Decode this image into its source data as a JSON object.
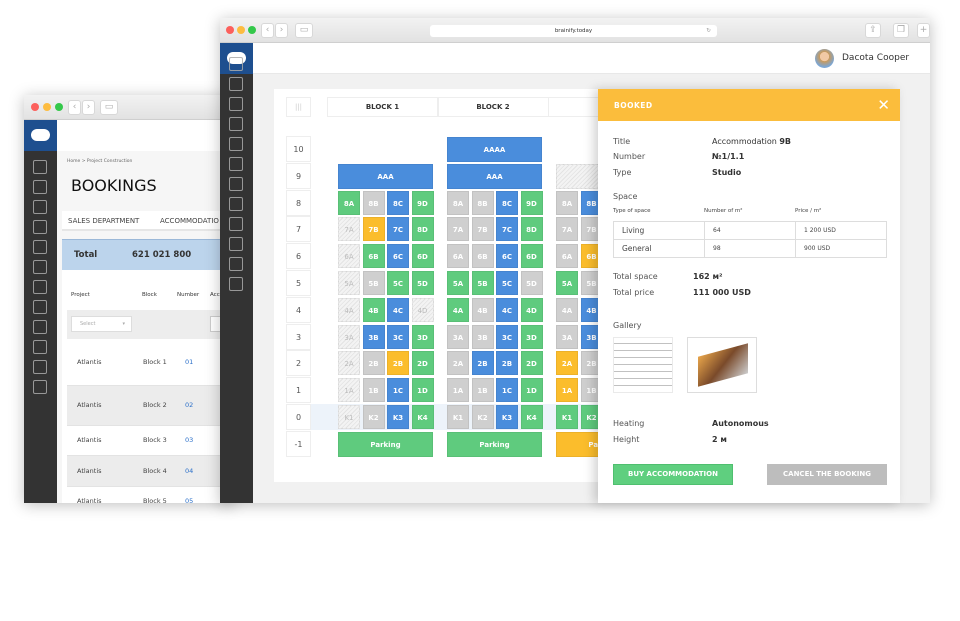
{
  "back_window": {
    "breadcrumb": "Home > Project Construction",
    "title": "BOOKINGS",
    "tabs": [
      "SALES DEPARTMENT",
      "ACCOMMODATIO"
    ],
    "total_label": "Total",
    "total_value": "621 021 800",
    "columns": [
      "Project",
      "Block",
      "Number",
      "Acc"
    ],
    "select_placeholder": "Select",
    "rows": [
      {
        "project": "Atlantis",
        "block": "Block 1",
        "number": "01"
      },
      {
        "project": "Atlantis",
        "block": "Block 2",
        "number": "02"
      },
      {
        "project": "Atlantis",
        "block": "Block 3",
        "number": "03"
      },
      {
        "project": "Atlantis",
        "block": "Block 4",
        "number": "04"
      },
      {
        "project": "Atlantis",
        "block": "Block 5",
        "number": "05"
      }
    ]
  },
  "browser": {
    "url": "brainify.today"
  },
  "user": {
    "name": "Dacota Cooper"
  },
  "sidebar_icons": [
    "user-icon",
    "buildings-icon",
    "city-icon",
    "box-icon",
    "handshake-icon",
    "document-icon",
    "card-icon",
    "bank-icon",
    "notebook-icon",
    "chart-icon",
    "house-icon",
    "file-icon"
  ],
  "grid": {
    "header_icon": "|||",
    "blocks": [
      "BLOCK 1",
      "BLOCK 2",
      "BL"
    ],
    "floors": [
      "10",
      "9",
      "8",
      "7",
      "6",
      "5",
      "4",
      "3",
      "2",
      "1",
      "0",
      "-1"
    ],
    "colors": {
      "green": "#5fcb7e",
      "blue": "#4a8ddc",
      "gray": "#cfcfcf",
      "yellow": "#fbbd2c"
    },
    "block_cells": [
      {
        "spans": [
          {
            "floor": "9",
            "label": "AAA",
            "status": "blue"
          },
          {
            "floor": "-1",
            "label": "Parking",
            "status": "green"
          }
        ],
        "units": {
          "8": [
            [
              "8A",
              "green"
            ],
            [
              "8B",
              "gray"
            ],
            [
              "8C",
              "blue"
            ],
            [
              "9D",
              "green"
            ]
          ],
          "7": [
            [
              "7A",
              "hatched"
            ],
            [
              "7B",
              "yellow"
            ],
            [
              "7C",
              "blue"
            ],
            [
              "8D",
              "green"
            ]
          ],
          "6": [
            [
              "6A",
              "hatched"
            ],
            [
              "6B",
              "green"
            ],
            [
              "6C",
              "blue"
            ],
            [
              "6D",
              "green"
            ]
          ],
          "5": [
            [
              "5A",
              "hatched"
            ],
            [
              "5B",
              "gray"
            ],
            [
              "5C",
              "green"
            ],
            [
              "5D",
              "green"
            ]
          ],
          "4": [
            [
              "4A",
              "hatched"
            ],
            [
              "4B",
              "green"
            ],
            [
              "4C",
              "blue"
            ],
            [
              "4D",
              "hatched"
            ]
          ],
          "3": [
            [
              "3A",
              "hatched"
            ],
            [
              "3B",
              "blue"
            ],
            [
              "3C",
              "blue"
            ],
            [
              "3D",
              "green"
            ]
          ],
          "2": [
            [
              "2A",
              "hatched"
            ],
            [
              "2B",
              "gray"
            ],
            [
              "2B",
              "yellow"
            ],
            [
              "2D",
              "green"
            ]
          ],
          "1": [
            [
              "1A",
              "hatched"
            ],
            [
              "1B",
              "gray"
            ],
            [
              "1C",
              "blue"
            ],
            [
              "1D",
              "green"
            ]
          ],
          "0": [
            [
              "K1",
              "hatched"
            ],
            [
              "K2",
              "gray"
            ],
            [
              "K3",
              "blue"
            ],
            [
              "K4",
              "green"
            ]
          ]
        }
      },
      {
        "spans": [
          {
            "floor": "10",
            "label": "AAAA",
            "status": "blue"
          },
          {
            "floor": "9",
            "label": "AAA",
            "status": "blue"
          },
          {
            "floor": "-1",
            "label": "Parking",
            "status": "green"
          }
        ],
        "units": {
          "8": [
            [
              "8A",
              "gray"
            ],
            [
              "8B",
              "gray"
            ],
            [
              "8C",
              "blue"
            ],
            [
              "9D",
              "green"
            ]
          ],
          "7": [
            [
              "7A",
              "gray"
            ],
            [
              "7B",
              "gray"
            ],
            [
              "7C",
              "blue"
            ],
            [
              "8D",
              "green"
            ]
          ],
          "6": [
            [
              "6A",
              "gray"
            ],
            [
              "6B",
              "gray"
            ],
            [
              "6C",
              "blue"
            ],
            [
              "6D",
              "green"
            ]
          ],
          "5": [
            [
              "5A",
              "green"
            ],
            [
              "5B",
              "green"
            ],
            [
              "5C",
              "blue"
            ],
            [
              "5D",
              "gray"
            ]
          ],
          "4": [
            [
              "4A",
              "green"
            ],
            [
              "4B",
              "gray"
            ],
            [
              "4C",
              "blue"
            ],
            [
              "4D",
              "green"
            ]
          ],
          "3": [
            [
              "3A",
              "gray"
            ],
            [
              "3B",
              "gray"
            ],
            [
              "3C",
              "blue"
            ],
            [
              "3D",
              "green"
            ]
          ],
          "2": [
            [
              "2A",
              "gray"
            ],
            [
              "2B",
              "blue"
            ],
            [
              "2B",
              "blue"
            ],
            [
              "2D",
              "green"
            ]
          ],
          "1": [
            [
              "1A",
              "gray"
            ],
            [
              "1B",
              "gray"
            ],
            [
              "1C",
              "blue"
            ],
            [
              "1D",
              "green"
            ]
          ],
          "0": [
            [
              "K1",
              "gray"
            ],
            [
              "K2",
              "gray"
            ],
            [
              "K3",
              "blue"
            ],
            [
              "K4",
              "green"
            ]
          ]
        }
      },
      {
        "spans": [
          {
            "floor": "9",
            "label": "",
            "status": "hatched"
          },
          {
            "floor": "-1",
            "label": "Parking",
            "status": "yellow"
          }
        ],
        "units": {
          "8": [
            [
              "8A",
              "gray"
            ],
            [
              "8B",
              "blue"
            ]
          ],
          "7": [
            [
              "7A",
              "gray"
            ],
            [
              "7B",
              "gray"
            ]
          ],
          "6": [
            [
              "6A",
              "gray"
            ],
            [
              "6B",
              "yellow"
            ]
          ],
          "5": [
            [
              "5A",
              "green"
            ],
            [
              "5B",
              "gray"
            ]
          ],
          "4": [
            [
              "4A",
              "gray"
            ],
            [
              "4B",
              "blue"
            ]
          ],
          "3": [
            [
              "3A",
              "gray"
            ],
            [
              "3B",
              "blue"
            ]
          ],
          "2": [
            [
              "2A",
              "yellow"
            ],
            [
              "2B",
              "gray"
            ]
          ],
          "1": [
            [
              "1A",
              "yellow"
            ],
            [
              "1B",
              "gray"
            ]
          ],
          "0": [
            [
              "K1",
              "green"
            ],
            [
              "K2",
              "green"
            ]
          ]
        }
      }
    ]
  },
  "panel": {
    "status": "BOOKED",
    "status_color": "#fbbd3c",
    "title_label": "Title",
    "title_value_prefix": "Accommodation",
    "title_value_bold": "9B",
    "number_label": "Number",
    "number_value": "№1/1.1",
    "type_label": "Type",
    "type_value": "Studio",
    "space_label": "Space",
    "space_columns": [
      "Type of space",
      "Number of m²",
      "Price / m²"
    ],
    "space_rows": [
      [
        "Living",
        "64",
        "1 200 USD"
      ],
      [
        "General",
        "98",
        "900 USD"
      ]
    ],
    "total_space_label": "Total space",
    "total_space_value": "162 м²",
    "total_price_label": "Total price",
    "total_price_value": "111 000 USD",
    "gallery_label": "Gallery",
    "heating_label": "Heating",
    "heating_value": "Autonomous",
    "height_label": "Height",
    "height_value": "2 м",
    "buy_label": "BUY ACCOMMODATION",
    "cancel_label": "CANCEL THE BOOKING"
  }
}
